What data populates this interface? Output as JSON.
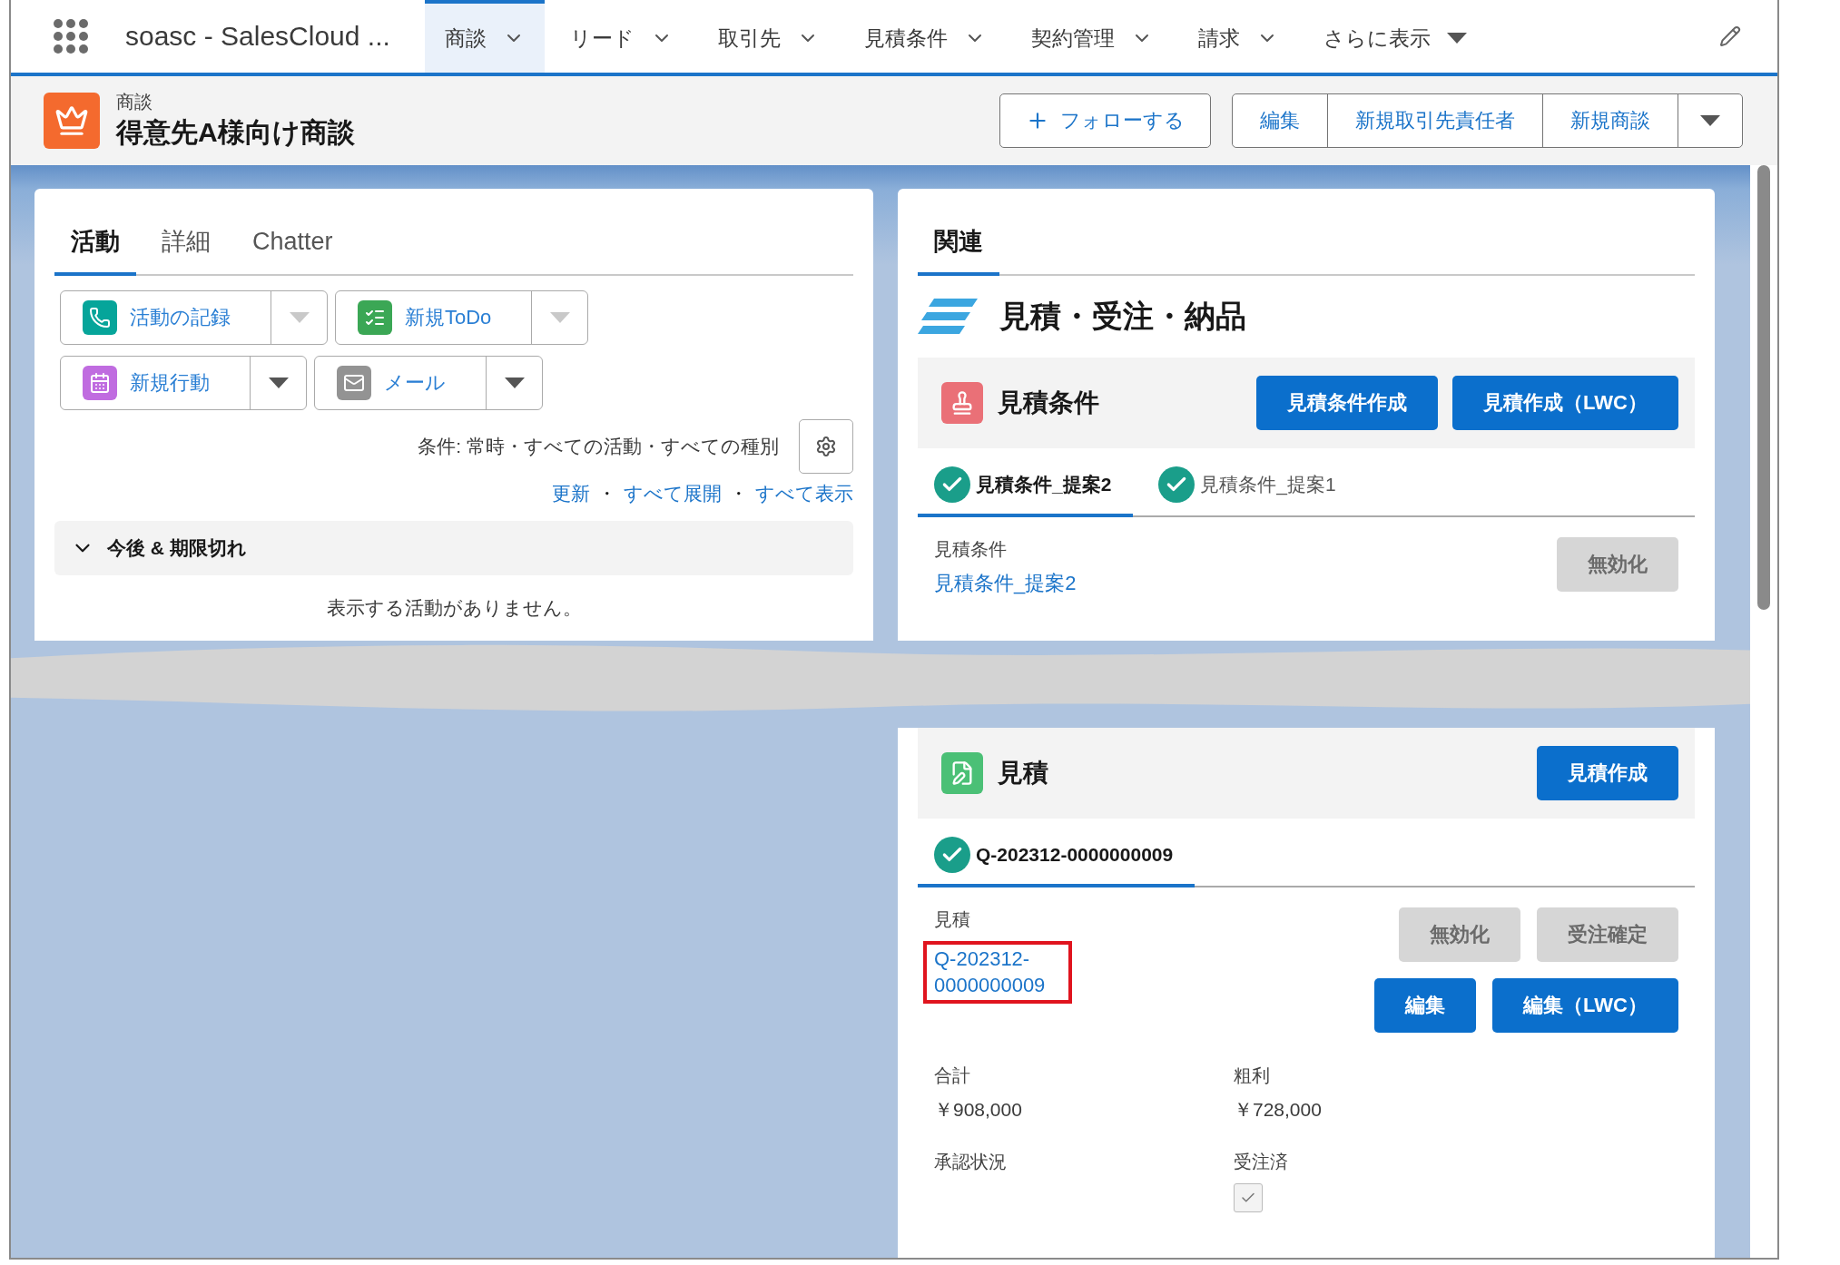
{
  "app_bar": {
    "app_name": "soasc - SalesCloud ...",
    "nav_items": [
      {
        "label": "商談",
        "selected": true,
        "kind": "menu"
      },
      {
        "label": "リード",
        "selected": false,
        "kind": "menu"
      },
      {
        "label": "取引先",
        "selected": false,
        "kind": "menu"
      },
      {
        "label": "見積条件",
        "selected": false,
        "kind": "menu"
      },
      {
        "label": "契約管理",
        "selected": false,
        "kind": "menu"
      },
      {
        "label": "請求",
        "selected": false,
        "kind": "menu"
      },
      {
        "label": "さらに表示",
        "selected": false,
        "kind": "more"
      }
    ]
  },
  "record_header": {
    "object_label": "商談",
    "title": "得意先A様向け商談",
    "follow_button": "フォローする",
    "actions": [
      "編集",
      "新規取引先責任者",
      "新規商談"
    ]
  },
  "activity_panel": {
    "tabs": [
      {
        "label": "活動",
        "selected": true
      },
      {
        "label": "詳細",
        "selected": false
      },
      {
        "label": "Chatter",
        "selected": false
      }
    ],
    "quick_actions": [
      {
        "label": "活動の記録",
        "kind": "log",
        "color": "#06a59a",
        "caret_muted": true
      },
      {
        "label": "新規ToDo",
        "kind": "task",
        "color": "#3ba755",
        "caret_muted": true
      },
      {
        "label": "新規行動",
        "kind": "event",
        "color": "#c06ce0",
        "caret_muted": false
      },
      {
        "label": "メール",
        "kind": "email",
        "color": "#939393",
        "caret_muted": false
      }
    ],
    "filter": "条件: 常時・すべての活動・すべての種別",
    "links": [
      "更新",
      "すべて展開",
      "すべて表示"
    ],
    "separator": "・",
    "section": {
      "title": "今後 & 期限切れ",
      "expanded": true
    },
    "empty_message": "表示する活動がありません。"
  },
  "related_panel": {
    "tabs": [
      {
        "label": "関連",
        "selected": true
      }
    ],
    "heading": "見積・受注・納品",
    "cards": [
      {
        "title": "見積条件",
        "kind": "terms",
        "color": "#ea7077",
        "buttons": [
          "見積条件作成",
          "見積作成（LWC）"
        ],
        "tabs": [
          {
            "label": "見積条件_提案2",
            "selected": true
          },
          {
            "label": "見積条件_提案1",
            "selected": false
          }
        ],
        "field_label": "見積条件",
        "field_link": "見積条件_提案2",
        "highlighted": false,
        "actions": [
          {
            "label": "無効化",
            "disabled": true
          }
        ]
      },
      {
        "title": "見積",
        "kind": "quote",
        "color": "#4bc076",
        "buttons": [
          "見積作成"
        ],
        "tabs": [
          {
            "label": "Q-202312-0000000009",
            "selected": true
          }
        ],
        "field_label": "見積",
        "field_link": "Q-202312-0000000009",
        "highlighted": true,
        "actions": [
          {
            "label": "無効化",
            "disabled": true
          },
          {
            "label": "受注確定",
            "disabled": true
          },
          {
            "label": "編集",
            "disabled": false
          },
          {
            "label": "編集（LWC）",
            "disabled": false
          }
        ],
        "fields": [
          {
            "label": "合計",
            "value": "￥908,000",
            "kind": "text"
          },
          {
            "label": "粗利",
            "value": "￥728,000",
            "kind": "text"
          },
          {
            "label": "承認状況",
            "kind": "text"
          },
          {
            "label": "受注済",
            "kind": "checkbox",
            "checked": true
          }
        ]
      }
    ]
  }
}
